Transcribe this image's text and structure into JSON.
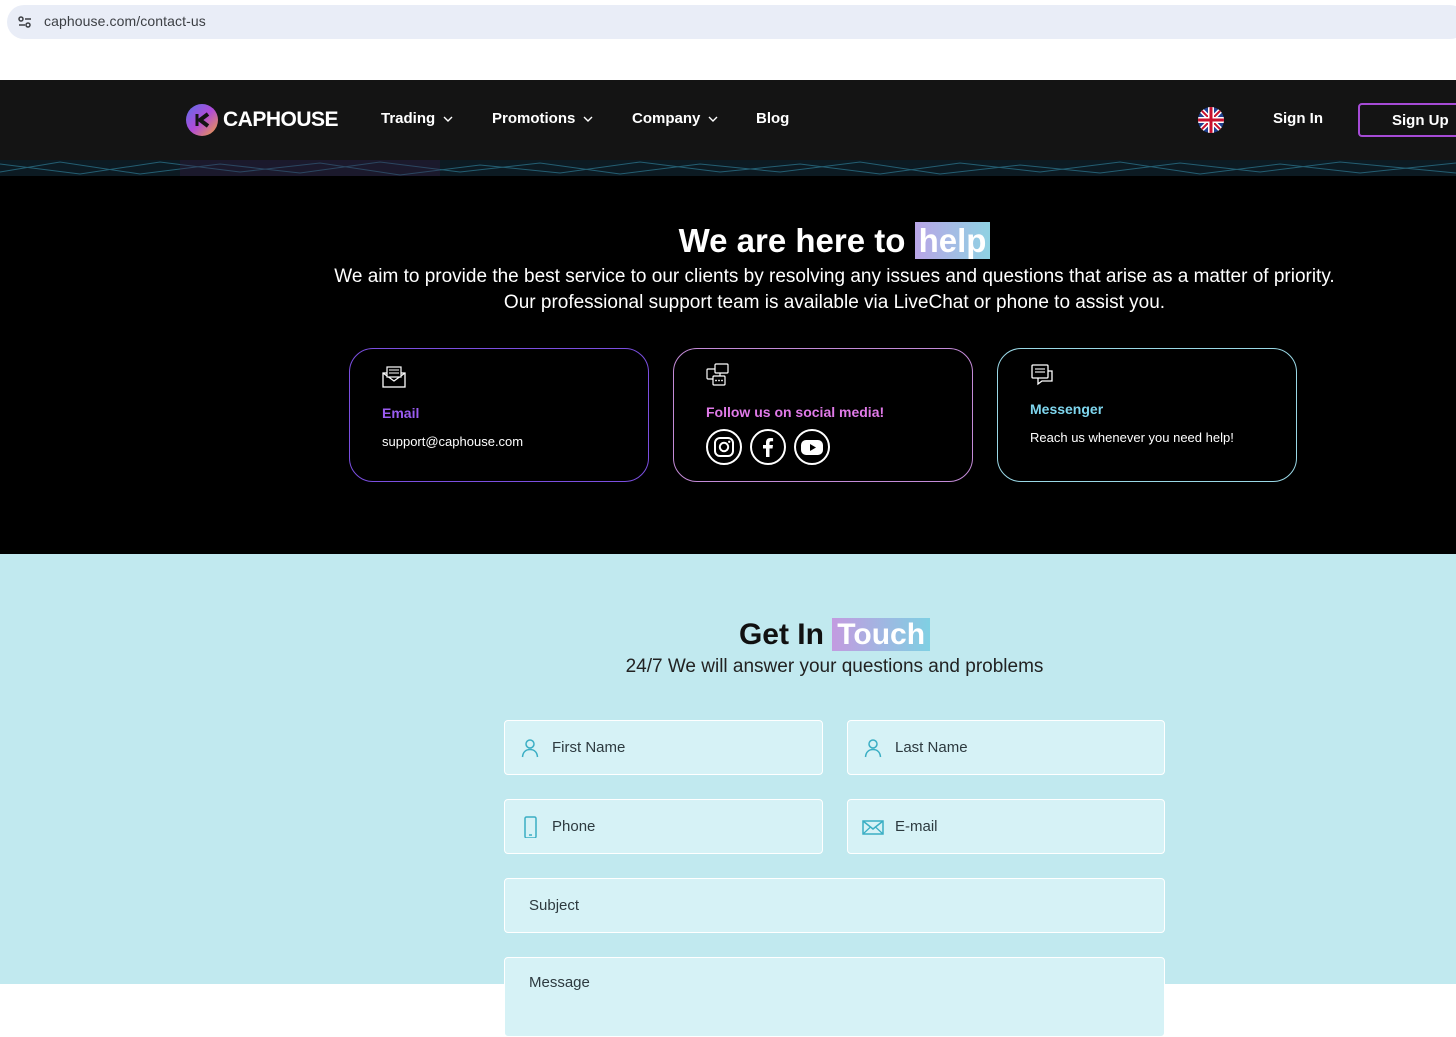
{
  "browser": {
    "url": "caphouse.com/contact-us",
    "site_info_icon": "tune-icon"
  },
  "nav": {
    "logo_text": "CAPHOUSE",
    "items": [
      {
        "label": "Trading",
        "has_dropdown": true
      },
      {
        "label": "Promotions",
        "has_dropdown": true
      },
      {
        "label": "Company",
        "has_dropdown": true
      },
      {
        "label": "Blog",
        "has_dropdown": false
      }
    ],
    "language_icon": "uk-flag-icon",
    "sign_in": "Sign In",
    "sign_up": "Sign Up"
  },
  "hero": {
    "title_prefix": "We are here to",
    "title_highlight": "help",
    "subtitle_line1": "We aim to provide the best service to our clients by resolving any issues and questions that arise as a matter of priority.",
    "subtitle_line2": "Our professional support team is available via LiveChat or phone to assist you."
  },
  "cards": [
    {
      "icon": "envelope-icon",
      "title": "Email",
      "text": "support@caphouse.com",
      "title_color": "#9a5cf0",
      "border_color": "#7b4fe0"
    },
    {
      "icon": "chat-bubbles-icon",
      "title": "Follow us on social media!",
      "title_color": "#e07ae8",
      "border_color": "#c48bd8",
      "socials": [
        "instagram-icon",
        "facebook-icon",
        "youtube-icon"
      ]
    },
    {
      "icon": "message-icon",
      "title": "Messenger",
      "text": "Reach us whenever you need help!",
      "title_color": "#7fd6ee",
      "border_color": "#9ad8e6"
    }
  ],
  "contact": {
    "title_prefix": "Get In",
    "title_highlight": "Touch",
    "subtitle": "24/7 We will answer your questions and problems",
    "fields": {
      "first_name": "First Name",
      "last_name": "Last Name",
      "phone": "Phone",
      "email": "E-mail",
      "subject": "Subject",
      "message": "Message"
    }
  },
  "colors": {
    "nav_bg": "#141414",
    "hero_bg": "#000000",
    "contact_bg": "#c1e9ef",
    "accent_purple": "#a64bd6",
    "field_icon": "#3aaec4"
  }
}
